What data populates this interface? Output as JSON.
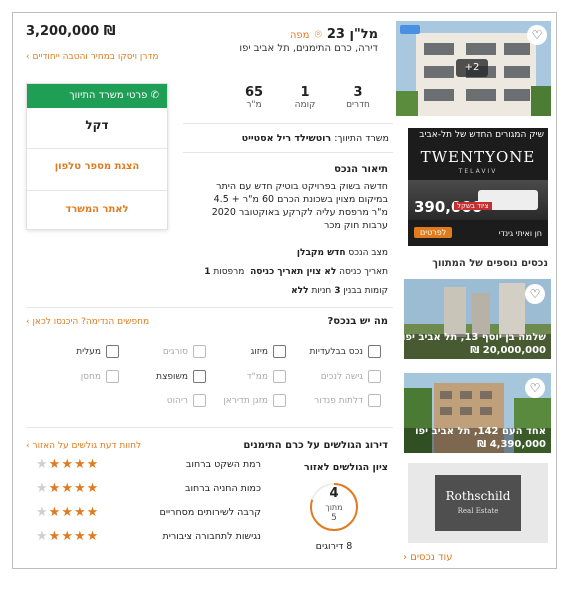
{
  "listing": {
    "price": "3,200,000 ₪",
    "title": "מל\"ן 23",
    "map_link": "מפה",
    "subtitle": "דירה, כרם התימנים, תל אביב יפו",
    "mortgage_link": "מדרן ויסקו במחיר והטבה ייחודיים",
    "image_count": "+2",
    "rooms_value": "3",
    "rooms_label": "חדרים",
    "floor_value": "1",
    "floor_label": "קומה",
    "size_value": "65",
    "size_label": "מ\"ר"
  },
  "agency_panel": {
    "contact_button": "פרטי משרד התיווך",
    "agent_name": "דקל",
    "show_phone": "הצגת מספר טלפון",
    "agency_site": "לאתר המשרד"
  },
  "agency": {
    "label": "משרד התיווך:",
    "name": "רוטשילד ריל אסטייט"
  },
  "description": {
    "heading": "תיאור הנכס",
    "lines": [
      "חדשה בשוק בפרויקט בוטיק חדש עם היתר",
      "במיקום מצוין בשכונת הכרם 60 מ\"ר + 4.5",
      "מ\"ר מרפסת עליה לקרקע באוקטובר 2020",
      "ערבות חוק מכר"
    ]
  },
  "details": {
    "condition_label": "מצב הנכס",
    "condition_value": "חדש מקבלן",
    "entry_label": "תאריך כניסה",
    "entry_value": "לא צוין תאריך כניסה",
    "balconies_label": "מרפסות",
    "balconies_value": "1",
    "floors_label": "קומות בבנין",
    "floors_value": "3",
    "parking_label": "חניות",
    "parking_value": "ללא"
  },
  "features": {
    "heading": "מה יש בנכס?",
    "link": "מחפשים הנדימה? היכנסו לכאן",
    "rows": [
      [
        "נכס בבלעדיות",
        "מיזוג",
        "סורגים",
        "מעלית"
      ],
      [
        "גישה לנכים",
        "ממ\"ד",
        "משופצת",
        "מחסן"
      ],
      [
        "דלתות פנדור",
        "מזגן תדיראן",
        "ריהוט",
        ""
      ]
    ],
    "icons": [
      [
        "diamond-icon",
        "snowflake-icon",
        "bars-icon",
        "elevator-icon"
      ],
      [
        "wheelchair-icon",
        "shelter-icon",
        "paint-roller-icon",
        "storage-icon"
      ],
      [
        "door-icon",
        "ac-unit-icon",
        "furniture-icon",
        ""
      ]
    ],
    "active": [
      [
        true,
        true,
        false,
        true
      ],
      [
        false,
        false,
        true,
        false
      ],
      [
        false,
        false,
        false,
        false
      ]
    ]
  },
  "ratings": {
    "heading": "דירוג הגולשים על כרם התימנים",
    "link": "לחוות דעת גולשים על האזור",
    "score_title": "ציון הגולשים לאזור",
    "score": "4",
    "score_of": "מתוך",
    "score_max": "5",
    "count": "8 דירוגים",
    "items": [
      {
        "label": "רמת השקט ברחוב",
        "stars": 4
      },
      {
        "label": "כמות החניה ברחוב",
        "stars": 4
      },
      {
        "label": "קרבה לשירותים מסחריים",
        "stars": 4
      },
      {
        "label": "נגישות לתחבורה ציבורית",
        "stars": 4
      }
    ]
  },
  "sidebar": {
    "ad_title": "שיק המגורים החדש של תל-אביב",
    "ad_brand": "TWENTYONE",
    "ad_brand_sub": "TELAVIV",
    "ad_price": "390,000",
    "ad_tag": "ציוד בשקל",
    "ad_details_button": "לפרטים",
    "ad_sponsor": "חן ואיתי גינדי",
    "more_heading": "נכסים נוספים של המתווך",
    "cards": [
      {
        "address": "שלמה בן יוסף 13, תל אביב יפו",
        "price": "20,000,000 ₪"
      },
      {
        "address": "אחד העם 142, תל אביב יפו",
        "price": "4,390,000 ₪"
      }
    ],
    "logo_name": "Rothschild",
    "logo_sub": "Real Estate",
    "more_link": "עוד נכסים"
  },
  "colors": {
    "accent": "#e07b1f",
    "green": "#1f9e56"
  }
}
